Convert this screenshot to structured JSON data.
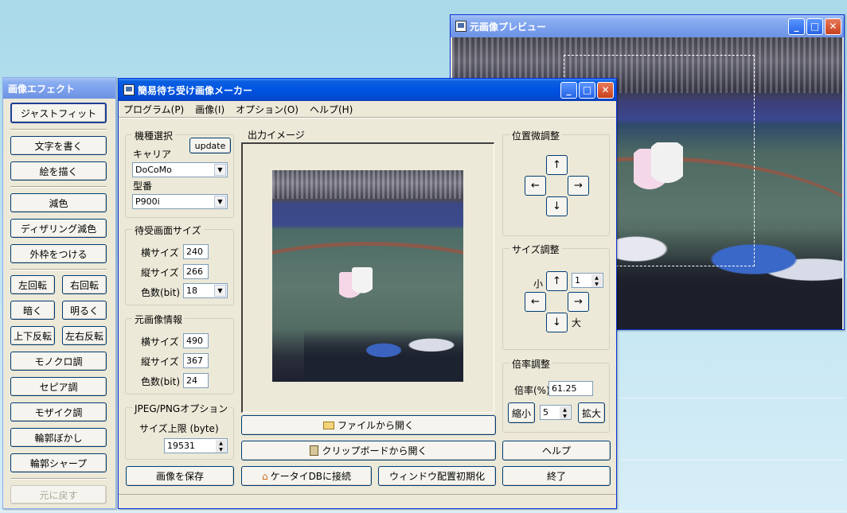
{
  "preview_window": {
    "title": "元画像プレビュー"
  },
  "effects_panel": {
    "title": "画像エフェクト",
    "buttons": {
      "just_fit": "ジャストフィット",
      "write_text": "文字を書く",
      "draw": "絵を描く",
      "reduce_color": "減色",
      "dither": "ディザリング減色",
      "frame": "外枠をつける",
      "rotate_left": "左回転",
      "rotate_right": "右回転",
      "darker": "暗く",
      "brighter": "明るく",
      "flip_v": "上下反転",
      "flip_h": "左右反転",
      "mono": "モノクロ調",
      "sepia": "セピア調",
      "mosaic": "モザイク調",
      "blur": "輪郭ぼかし",
      "sharpen": "輪郭シャープ",
      "undo": "元に戻す"
    }
  },
  "main_window": {
    "title": "簡易待ち受け画像メーカー",
    "menu": [
      "プログラム(P)",
      "画像(I)",
      "オプション(O)",
      "ヘルプ(H)"
    ],
    "model": {
      "group": "機種選択",
      "update": "update",
      "carrier_label": "キャリア",
      "carrier_value": "DoCoMo",
      "model_label": "型番",
      "model_value": "P900i"
    },
    "screen": {
      "group": "待受画面サイズ",
      "width_label": "横サイズ",
      "width": "240",
      "height_label": "縦サイズ",
      "height": "266",
      "colors_label": "色数(bit)",
      "colors": "18"
    },
    "source": {
      "group": "元画像情報",
      "width_label": "横サイズ",
      "width": "490",
      "height_label": "縦サイズ",
      "height": "367",
      "colors_label": "色数(bit)",
      "colors": "24"
    },
    "jpeg": {
      "group": "JPEG/PNGオプション",
      "limit_label": "サイズ上限 (byte)",
      "limit": "19531"
    },
    "output": {
      "label": "出力イメージ"
    },
    "position": {
      "group": "位置微調整",
      "up": "↑",
      "left": "←",
      "right": "→",
      "down": "↓"
    },
    "size": {
      "group": "サイズ調整",
      "small": "小",
      "large": "大",
      "step": "1",
      "up": "↑",
      "left": "←",
      "right": "→",
      "down": "↓"
    },
    "zoom": {
      "group": "倍率調整",
      "rate_label": "倍率(%)",
      "rate": "61.25",
      "shrink": "縮小",
      "step": "5",
      "enlarge": "拡大"
    },
    "buttons": {
      "open_file": "ファイルから開く",
      "open_clip": "クリップボードから開く",
      "help": "ヘルプ",
      "save": "画像を保存",
      "connect": "ケータイDBに接続",
      "reset_layout": "ウィンドウ配置初期化",
      "exit": "終了"
    }
  }
}
